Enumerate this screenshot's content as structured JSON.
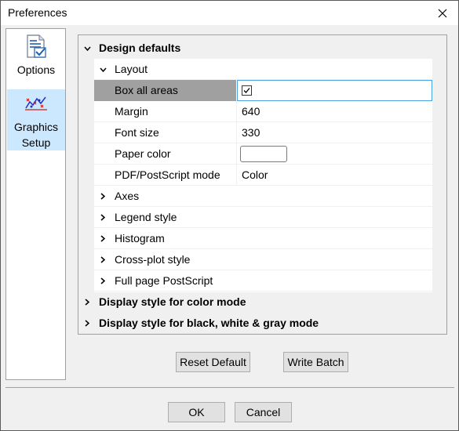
{
  "window": {
    "title": "Preferences"
  },
  "sidebar": {
    "items": [
      {
        "label": "Options",
        "icon": "document-check-icon"
      },
      {
        "label": "Graphics Setup",
        "icon": "chart-plot-icon"
      }
    ]
  },
  "tree": {
    "design_defaults": "Design defaults",
    "layout": "Layout",
    "properties": [
      {
        "name": "Box all areas",
        "value": "checked"
      },
      {
        "name": "Margin",
        "value": "640"
      },
      {
        "name": "Font size",
        "value": "330"
      },
      {
        "name": "Paper color",
        "value": ""
      },
      {
        "name": "PDF/PostScript mode",
        "value": "Color"
      }
    ],
    "collapsed_children": [
      "Axes",
      "Legend style",
      "Histogram",
      "Cross-plot style",
      "Full page PostScript"
    ],
    "collapsed_sections": [
      "Display style for color mode",
      "Display style for black, white & gray mode"
    ]
  },
  "buttons": {
    "reset_default": "Reset Default",
    "write_batch": "Write Batch",
    "ok": "OK",
    "cancel": "Cancel"
  },
  "colors": {
    "selection_highlight": "#cce8ff",
    "selected_row": "#a0a0a0",
    "focus_border": "#4aa3df"
  }
}
